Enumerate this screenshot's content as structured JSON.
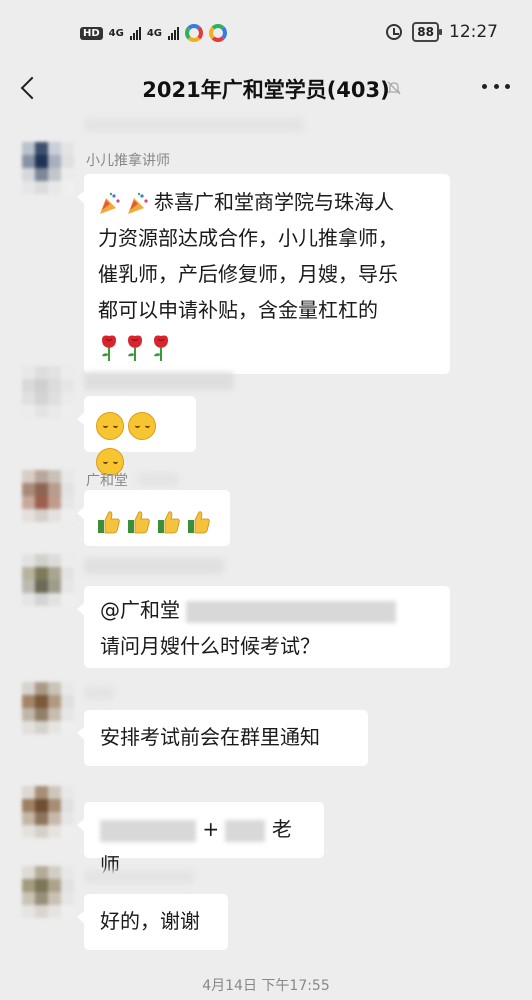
{
  "status_bar": {
    "left_badges": [
      "HD",
      "4G",
      "4G"
    ],
    "battery": "88",
    "time": "12:27"
  },
  "nav": {
    "title": "2021年广和堂学员(403)",
    "back_icon": "back-chevron-icon",
    "mute_icon": "mute-bell-icon",
    "more_icon": "more-dots-icon"
  },
  "messages": [
    {
      "sender": "小儿推拿讲师",
      "text_line1": "恭喜广和堂商学院与珠海人",
      "text_line2": "力资源部达成合作，小儿推拿师，",
      "text_line3": "催乳师，产后修复师，月嫂，导乐",
      "text_line4": "都可以申请补贴，含金量杠杠的",
      "emojis_pre": [
        "party-popper-icon",
        "party-popper-icon"
      ],
      "emojis_post": [
        "rose-icon",
        "rose-icon",
        "rose-icon"
      ]
    },
    {
      "emojis": [
        "hugging-face-icon",
        "hugging-face-icon",
        "hugging-face-icon"
      ]
    },
    {
      "sender": "广和堂",
      "emojis": [
        "thumbs-up-icon",
        "thumbs-up-icon",
        "thumbs-up-icon",
        "thumbs-up-icon"
      ]
    },
    {
      "mention": "@广和堂",
      "text": "请问月嫂什么时候考试？"
    },
    {
      "text": "安排考试前会在群里通知"
    },
    {
      "plus": "+",
      "text": "老师"
    },
    {
      "text": "好的，谢谢"
    }
  ],
  "timestamp": "4月14日 下午17:55"
}
